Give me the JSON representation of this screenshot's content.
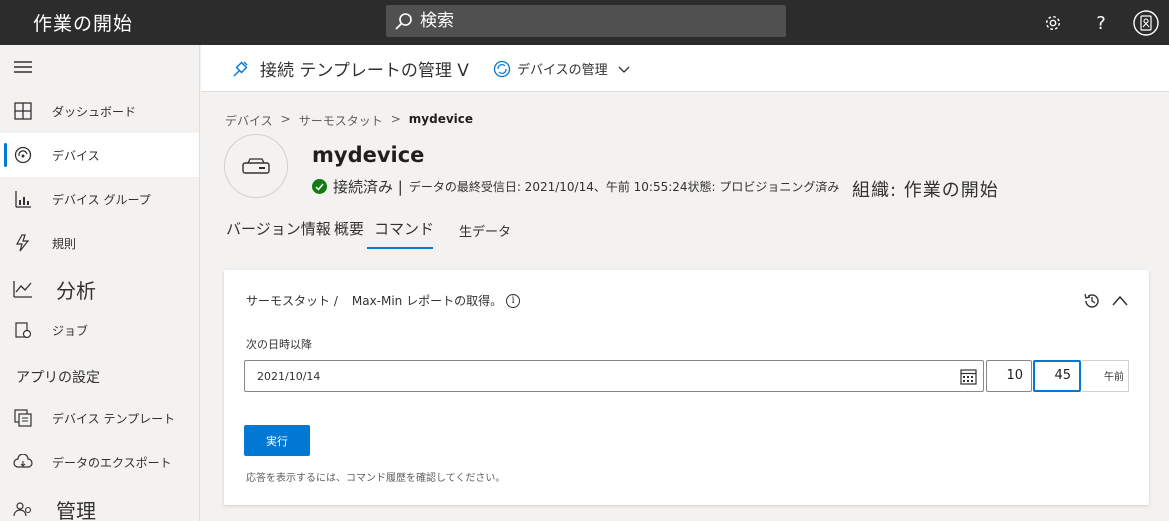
{
  "topbar": {
    "title": "作業の開始",
    "search_placeholder": "検索",
    "icons": [
      "gear-icon",
      "help-icon",
      "account-icon"
    ]
  },
  "sidebar": {
    "items": [
      {
        "label": "ダッシュボード",
        "icon": "dashboard-icon"
      },
      {
        "label": "デバイス",
        "icon": "devices-icon",
        "active": true
      },
      {
        "label": "デバイス グループ",
        "icon": "device-groups-icon"
      },
      {
        "label": "規則",
        "icon": "rules-icon"
      },
      {
        "label": "分析",
        "icon": "analytics-icon"
      },
      {
        "label": "ジョブ",
        "icon": "jobs-icon"
      }
    ],
    "section_app_settings": "アプリの設定",
    "items2": [
      {
        "label": "デバイス テンプレート",
        "icon": "device-templates-icon"
      },
      {
        "label": "データのエクスポート",
        "icon": "data-export-icon"
      },
      {
        "label": "管理",
        "icon": "admin-icon"
      }
    ]
  },
  "commandbar": {
    "connect_template_label": "接続 テンプレートの管理 V",
    "manage_device_label": "デバイスの管理"
  },
  "breadcrumb": [
    "デバイス",
    ">",
    "サーモスタット",
    ">",
    "mydevice"
  ],
  "device": {
    "name": "mydevice",
    "status": "接続済み |",
    "last_received": "データの最終受信日: 2021/10/14、午前 10:55:24状態: プロビジョニング済み",
    "organization": "組織: 作業の開始"
  },
  "tabs": [
    {
      "label": "バージョン情報"
    },
    {
      "label": "概要"
    },
    {
      "label": "コマンド",
      "active": true
    },
    {
      "label": "生データ"
    }
  ],
  "command_card": {
    "breadcrumb": "サーモスタット /",
    "command_name": "Max-Min レポートの取得。",
    "field_label": "次の日時以降",
    "date_value": "2021/10/14",
    "hour_value": "10",
    "minute_value": "45",
    "ampm": "午前",
    "run_label": "実行",
    "hint": "応答を表示するには、コマンド履歴を確認してください。"
  },
  "colors": {
    "accent": "#0078d4",
    "topbar": "#2c2c2c",
    "success": "#107c10"
  }
}
